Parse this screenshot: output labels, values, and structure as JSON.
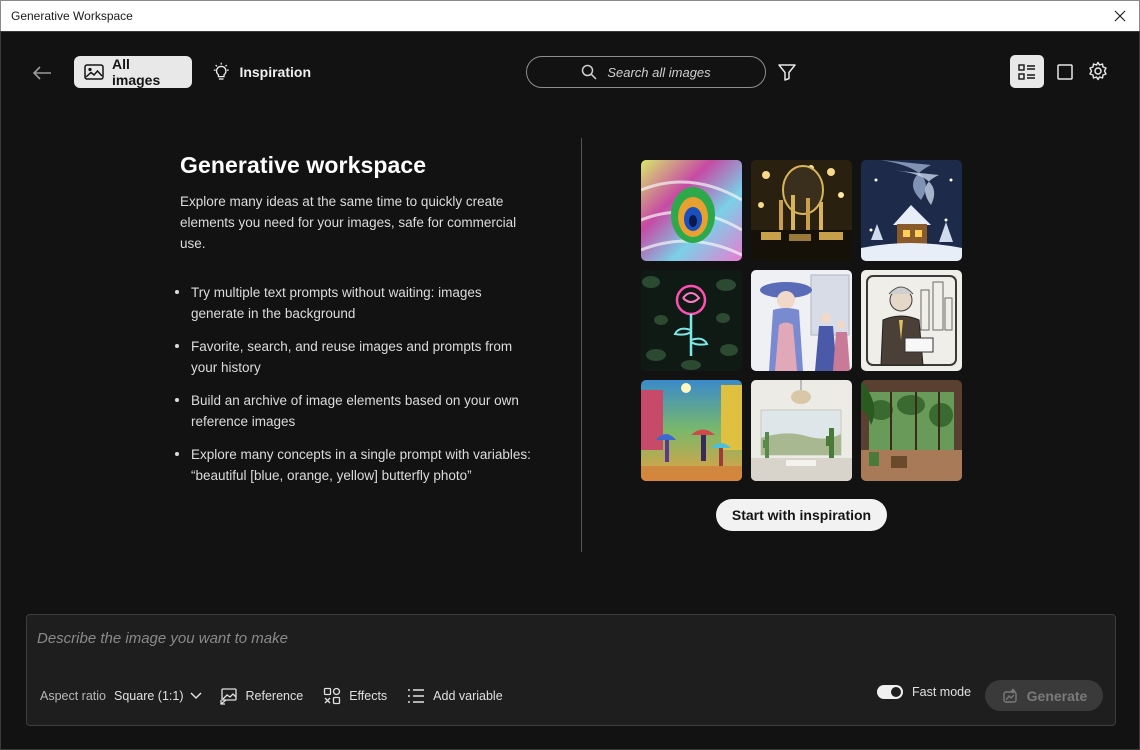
{
  "window": {
    "title": "Generative Workspace"
  },
  "toolbar": {
    "all_images_label": "All images",
    "inspiration_label": "Inspiration",
    "search_placeholder": "Search all images"
  },
  "intro": {
    "title": "Generative workspace",
    "description": "Explore many ideas at the same time to quickly create elements you need for your images, safe for commercial use.",
    "bullets": [
      "Try multiple text prompts without waiting: images generate in the background",
      "Favorite, search, and reuse images and prompts from your history",
      "Build an archive of image elements based on your own reference images",
      "Explore many concepts in a single prompt with variables: “beautiful [blue, orange, yellow] butterfly photo”"
    ]
  },
  "gallery": {
    "start_button": "Start with inspiration"
  },
  "prompt": {
    "placeholder": "Describe the image you want to make",
    "aspect_label": "Aspect ratio",
    "aspect_value": "Square (1:1)",
    "reference_label": "Reference",
    "effects_label": "Effects",
    "add_variable_label": "Add variable",
    "fast_mode_label": "Fast mode",
    "fast_mode_on": true,
    "generate_label": "Generate"
  }
}
